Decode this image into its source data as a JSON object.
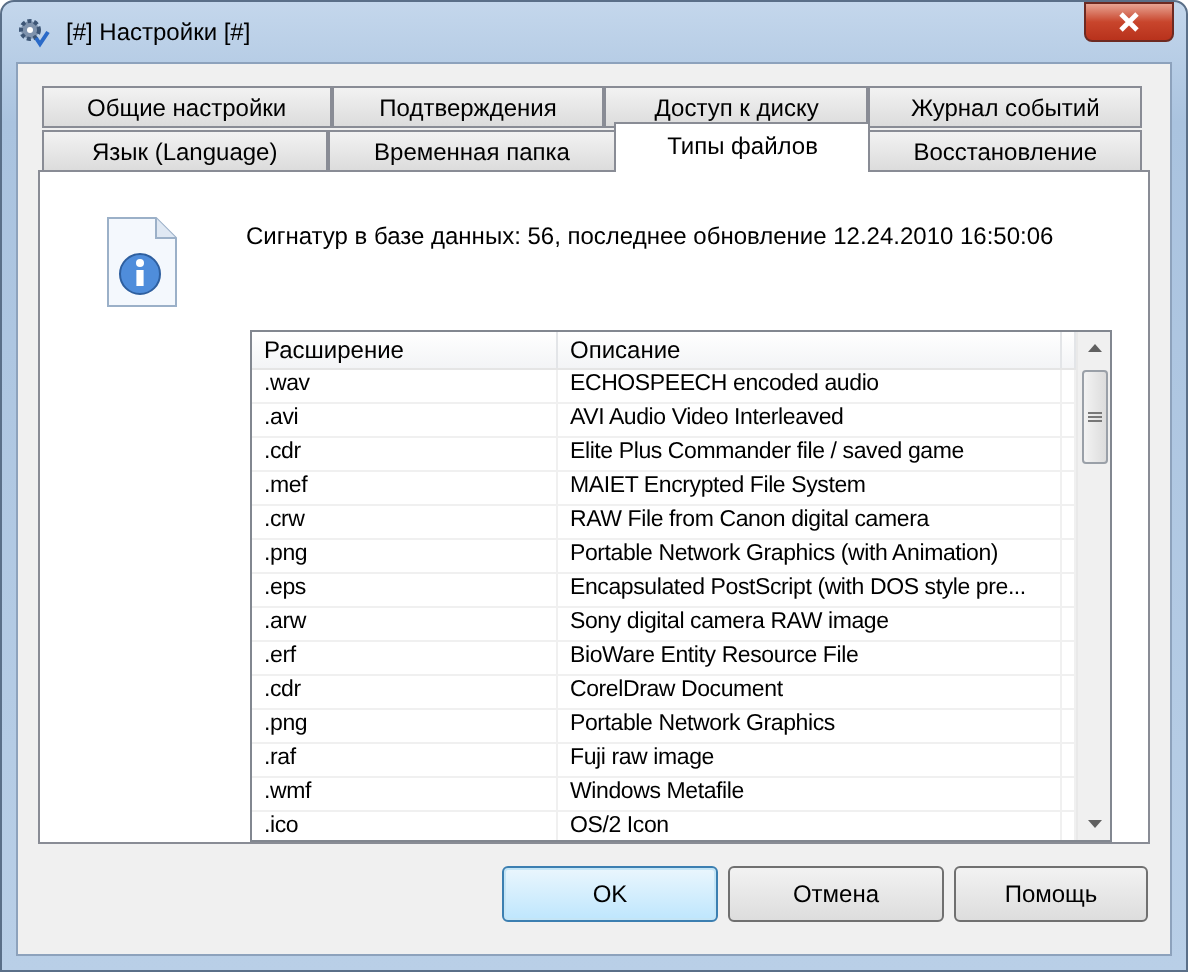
{
  "window": {
    "title": "[#] Настройки [#]"
  },
  "tabs": [
    [
      {
        "label": "Общие настройки",
        "selected": false
      },
      {
        "label": "Подтверждения",
        "selected": false
      },
      {
        "label": "Доступ к диску",
        "selected": false
      },
      {
        "label": "Журнал событий",
        "selected": false
      }
    ],
    [
      {
        "label": "Язык (Language)",
        "selected": false
      },
      {
        "label": "Временная папка",
        "selected": false
      },
      {
        "label": "Типы файлов",
        "selected": true
      },
      {
        "label": "Восстановление",
        "selected": false
      }
    ]
  ],
  "info": "Сигнатур в базе данных: 56, последнее обновление 12.24.2010 16:50:06",
  "table": {
    "columns": [
      "Расширение",
      "Описание"
    ],
    "rows": [
      [
        ".wav",
        "ECHOSPEECH encoded audio"
      ],
      [
        ".avi",
        "AVI Audio Video Interleaved"
      ],
      [
        ".cdr",
        "Elite Plus Commander file / saved game"
      ],
      [
        ".mef",
        "MAIET Encrypted File System"
      ],
      [
        ".crw",
        "RAW File from Canon digital camera"
      ],
      [
        ".png",
        "Portable Network Graphics (with Animation)"
      ],
      [
        ".eps",
        "Encapsulated PostScript (with DOS style pre..."
      ],
      [
        ".arw",
        "Sony digital camera RAW image"
      ],
      [
        ".erf",
        "BioWare Entity Resource File"
      ],
      [
        ".cdr",
        "CorelDraw Document"
      ],
      [
        ".png",
        "Portable Network Graphics"
      ],
      [
        ".raf",
        "Fuji raw image"
      ],
      [
        ".wmf",
        "Windows Metafile"
      ],
      [
        ".ico",
        "OS/2 Icon"
      ]
    ]
  },
  "buttons": [
    {
      "label": "OK",
      "selected": true
    },
    {
      "label": "Отмена",
      "selected": false
    },
    {
      "label": "Помощь",
      "selected": false
    }
  ]
}
